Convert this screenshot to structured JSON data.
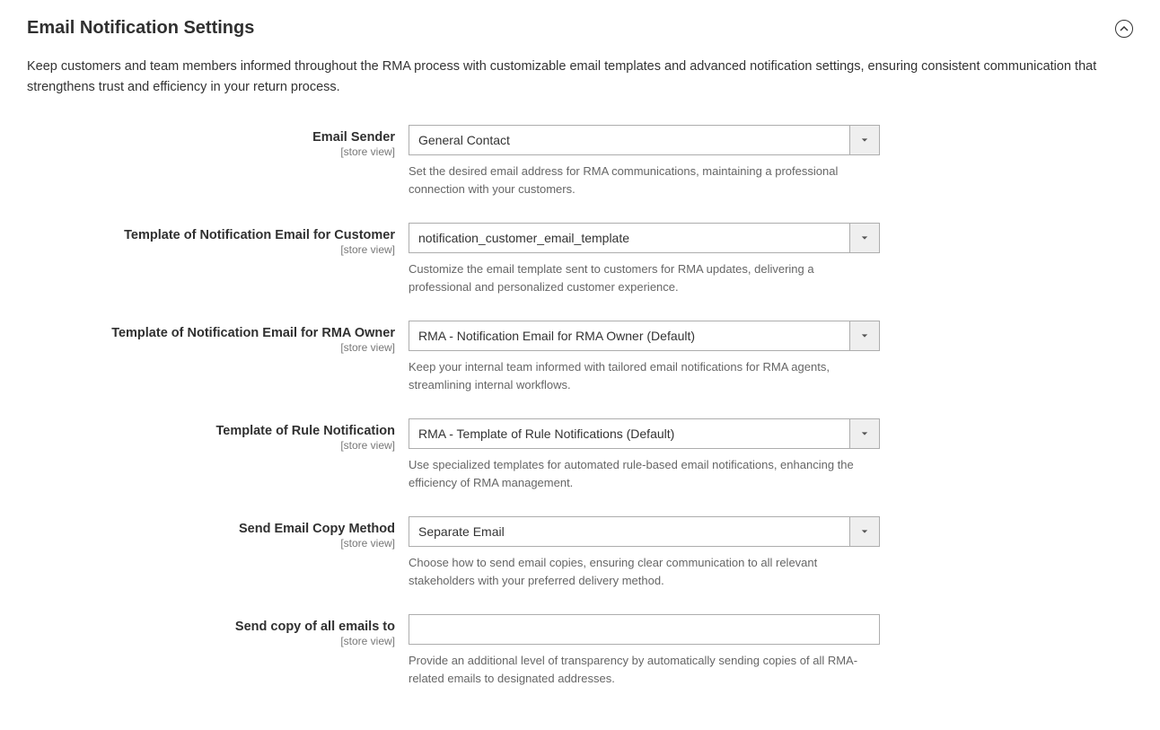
{
  "section": {
    "title": "Email Notification Settings",
    "description": "Keep customers and team members informed throughout the RMA process with customizable email templates and advanced notification settings, ensuring consistent communication that strengthens trust and efficiency in your return process."
  },
  "scope_label": "[store view]",
  "fields": {
    "email_sender": {
      "label": "Email Sender",
      "value": "General Contact",
      "help": "Set the desired email address for RMA communications, maintaining a professional connection with your customers."
    },
    "template_customer": {
      "label": "Template of Notification Email for Customer",
      "value": "notification_customer_email_template",
      "help": "Customize the email template sent to customers for RMA updates, delivering a professional and personalized customer experience."
    },
    "template_owner": {
      "label": "Template of Notification Email for RMA Owner",
      "value": "RMA - Notification Email for RMA Owner (Default)",
      "help": "Keep your internal team informed with tailored email notifications for RMA agents, streamlining internal workflows."
    },
    "template_rule": {
      "label": "Template of Rule Notification",
      "value": "RMA - Template of Rule Notifications (Default)",
      "help": "Use specialized templates for automated rule-based email notifications, enhancing the efficiency of RMA management."
    },
    "copy_method": {
      "label": "Send Email Copy Method",
      "value": "Separate Email",
      "help": "Choose how to send email copies, ensuring clear communication to all relevant stakeholders with your preferred delivery method."
    },
    "copy_to": {
      "label": "Send copy of all emails to",
      "value": "",
      "help": "Provide an additional level of transparency by automatically sending copies of all RMA-related emails to designated addresses."
    }
  }
}
